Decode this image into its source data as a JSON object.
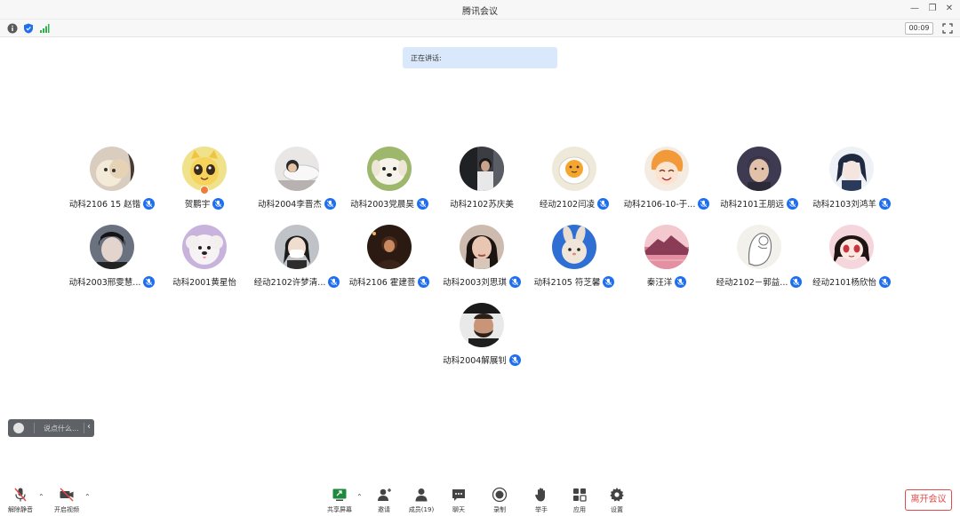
{
  "window": {
    "title": "腾讯会议"
  },
  "status": {
    "timer": "00:09"
  },
  "speaking": {
    "label": "正在讲话:"
  },
  "participants": [
    {
      "name": "动科2106 15 赵锴",
      "avatar": "cartoon-bear",
      "mic": true
    },
    {
      "name": "贺鹏宇",
      "avatar": "yellow-cat",
      "mic": true,
      "host": true
    },
    {
      "name": "动科2004李晋杰",
      "avatar": "person-lying",
      "mic": true
    },
    {
      "name": "动科2003党晨昊",
      "avatar": "white-dog",
      "mic": true
    },
    {
      "name": "动科2102苏庆美",
      "avatar": "dark-photo",
      "mic": false
    },
    {
      "name": "经动2102闫凌",
      "avatar": "egg-face",
      "mic": true
    },
    {
      "name": "动科2106-10-于...",
      "avatar": "anime-orange-hair",
      "mic": true
    },
    {
      "name": "动科2101王朋远",
      "avatar": "man-portrait",
      "mic": true
    },
    {
      "name": "动科2103刘鸿羊",
      "avatar": "anime-dark",
      "mic": true
    },
    {
      "name": "动科2003邢雯慧...",
      "avatar": "man-dark-hair",
      "mic": true
    },
    {
      "name": "动科2001黄星怡",
      "avatar": "fluffy-dog",
      "mic": false
    },
    {
      "name": "经动2102许梦清...",
      "avatar": "girl-mask",
      "mic": true
    },
    {
      "name": "动科2106 霍建菩",
      "avatar": "night-photo",
      "mic": true
    },
    {
      "name": "动科2003刘思琪",
      "avatar": "girl-portrait",
      "mic": true
    },
    {
      "name": "动科2105 符芝馨",
      "avatar": "bunny-plush",
      "mic": true
    },
    {
      "name": "秦汪洋",
      "avatar": "pink-mountain",
      "mic": true
    },
    {
      "name": "经动2102－郭益...",
      "avatar": "sketch-figure",
      "mic": true
    },
    {
      "name": "经动2101杨欣怡",
      "avatar": "anime-girl-red",
      "mic": true
    },
    {
      "name": "动科2004解展钊",
      "avatar": "man-beard",
      "mic": true
    }
  ],
  "chat": {
    "placeholder": "说点什么..."
  },
  "toolbar": {
    "unmute": "解除静音",
    "start_video": "开启视频",
    "share_screen": "共享屏幕",
    "invite": "邀请",
    "members": "成员(19)",
    "chat": "聊天",
    "record": "录制",
    "raise_hand": "举手",
    "apps": "应用",
    "settings": "设置",
    "leave": "离开会议"
  },
  "colors": {
    "accent": "#1e6ff0",
    "speaking_bg": "#d9e8fb",
    "leave": "#e24a4a",
    "signal": "#2cb34a"
  }
}
